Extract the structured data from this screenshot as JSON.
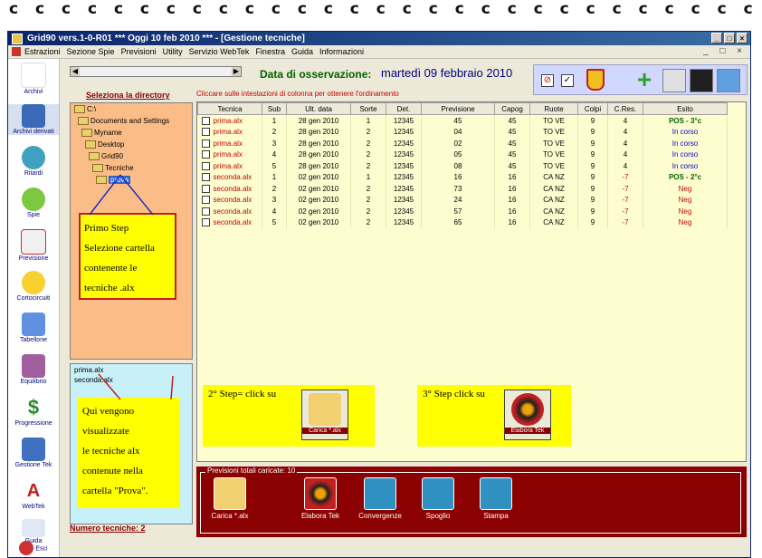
{
  "window": {
    "title": "Grid90 vers.1-0-R01  ***  Oggi 10 feb 2010  ***  - [Gestione tecniche]"
  },
  "menu": [
    "Estrazioni",
    "Sezione Spie",
    "Previsioni",
    "Utility",
    "Servizio WebTek",
    "Finestra",
    "Guida",
    "Informazioni"
  ],
  "toolbar_left": [
    "Archivi",
    "Archivi derivati",
    "Ritardi",
    "Spie",
    "Previsione",
    "Cortocircuiti",
    "Tabellone",
    "Equilibrio",
    "Progressione",
    "Gestione Tek",
    "WebTek",
    "Guida",
    "Esci"
  ],
  "header": {
    "date_label": "Data di osservazione:",
    "date_value": "martedì 09 febbraio 2010",
    "hint": "Cliccare sulle intestazioni di colonna per ottenere l'ordinamento"
  },
  "directory": {
    "label": "Seleziona la directory",
    "items": [
      "C:\\",
      "Documents and Settings",
      "Myname",
      "Desktop",
      "Grid90",
      "Tecniche",
      "prova"
    ]
  },
  "files": {
    "items": [
      "prima.alx",
      "seconda.alx"
    ],
    "count_label": "Numero tecniche: 2"
  },
  "table": {
    "columns": [
      "Tecnica",
      "Sub",
      "Ult. data",
      "Sorte",
      "Det.",
      "Previsione",
      "Capog",
      "Ruote",
      "Colpi",
      "C.Res.",
      "Esito"
    ],
    "rows": [
      [
        "prima.alx",
        "1",
        "28 gen 2010",
        "1",
        "12345",
        "45",
        "45",
        "TO VE",
        "9",
        "4",
        "POS - 3°c"
      ],
      [
        "prima.alx",
        "2",
        "28 gen 2010",
        "2",
        "12345",
        "04",
        "45",
        "TO VE",
        "9",
        "4",
        "In corso"
      ],
      [
        "prima.alx",
        "3",
        "28 gen 2010",
        "2",
        "12345",
        "02",
        "45",
        "TO VE",
        "9",
        "4",
        "In corso"
      ],
      [
        "prima.alx",
        "4",
        "28 gen 2010",
        "2",
        "12345",
        "05",
        "45",
        "TO VE",
        "9",
        "4",
        "In corso"
      ],
      [
        "prima.alx",
        "5",
        "28 gen 2010",
        "2",
        "12345",
        "08",
        "45",
        "TO VE",
        "9",
        "4",
        "In corso"
      ],
      [
        "seconda.alx",
        "1",
        "02 gen 2010",
        "1",
        "12345",
        "16",
        "16",
        "CA NZ",
        "9",
        "-7",
        "POS - 2°c"
      ],
      [
        "seconda.alx",
        "2",
        "02 gen 2010",
        "2",
        "12345",
        "73",
        "16",
        "CA NZ",
        "9",
        "-7",
        "Neg"
      ],
      [
        "seconda.alx",
        "3",
        "02 gen 2010",
        "2",
        "12345",
        "24",
        "16",
        "CA NZ",
        "9",
        "-7",
        "Neg"
      ],
      [
        "seconda.alx",
        "4",
        "02 gen 2010",
        "2",
        "12345",
        "57",
        "16",
        "CA NZ",
        "9",
        "-7",
        "Neg"
      ],
      [
        "seconda.alx",
        "5",
        "02 gen 2010",
        "2",
        "12345",
        "65",
        "16",
        "CA NZ",
        "9",
        "-7",
        "Neg"
      ]
    ]
  },
  "bottom": {
    "legend": "Previsioni totali caricate: 10",
    "buttons": [
      "Carica *.alx",
      "Elabora Tek",
      "Convergenze",
      "Spoglio",
      "Stampa"
    ]
  },
  "callouts": {
    "step1": [
      "Primo Step",
      "Selezione cartella",
      "contenente le",
      "tecniche .alx"
    ],
    "step2": "2° Step= click su",
    "step2_btn": "Carica *.alx",
    "step3": "3° Step click su",
    "step3_btn": "Elabora Tek",
    "files_note": [
      "Qui vengono",
      "visualizzate",
      "le tecniche alx",
      "contenute nella",
      "cartella \"Prova\"."
    ]
  },
  "colors": {
    "bottom_panel": "#8b0000",
    "grid_bg": "#fdfdd0",
    "dir_bg": "#fbbd87",
    "callout": "#ffff00"
  }
}
